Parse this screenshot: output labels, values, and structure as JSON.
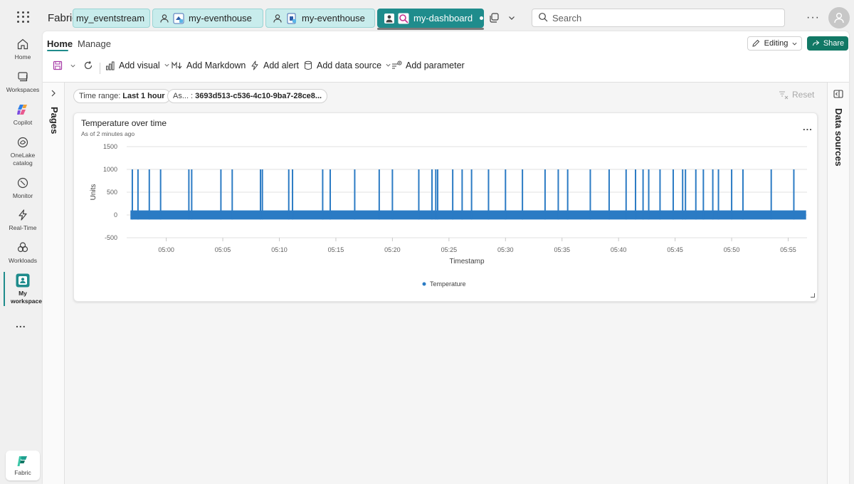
{
  "app": {
    "brand": "Fabric"
  },
  "tabs": [
    {
      "label": "my_eventstream"
    },
    {
      "label": "my-eventhouse"
    },
    {
      "label": "my-eventhouse"
    },
    {
      "label": "my-dashboard",
      "active": true
    }
  ],
  "search": {
    "placeholder": "Search"
  },
  "rail": {
    "items": [
      {
        "label": "Home"
      },
      {
        "label": "Workspaces"
      },
      {
        "label": "Copilot"
      },
      {
        "label": "OneLake catalog"
      },
      {
        "label": "Monitor"
      },
      {
        "label": "Real-Time"
      },
      {
        "label": "Workloads"
      },
      {
        "label": "My workspace"
      }
    ],
    "more": "...",
    "fabric_label": "Fabric"
  },
  "ribbon": {
    "tabs": [
      "Home",
      "Manage"
    ],
    "editing_label": "Editing",
    "share_label": "Share"
  },
  "toolbar": {
    "add_visual": "Add visual",
    "add_markdown": "Add Markdown",
    "add_alert": "Add alert",
    "add_data_source": "Add data source",
    "add_parameter": "Add parameter"
  },
  "pages_label": "Pages",
  "data_sources_label": "Data sources",
  "filters": {
    "time_range_label": "Time range:",
    "time_range_value": "Last 1 hour",
    "param_label": "As... :",
    "param_value": "3693d513-c536-4c10-9ba7-28ce8...",
    "reset_label": "Reset"
  },
  "tile": {
    "title": "Temperature over time",
    "subtitle": "As of 2 minutes ago",
    "more": "..."
  },
  "colors": {
    "accent": "#1f8c8c",
    "share": "#117865",
    "series": "#2b7bc4"
  },
  "chart_data": {
    "type": "line",
    "xlabel": "Timestamp",
    "ylabel": "Units",
    "ylim": [
      -500,
      1500
    ],
    "yticks": [
      1500,
      1000,
      500,
      0,
      -500
    ],
    "xticks": [
      "05:00",
      "05:05",
      "05:10",
      "05:15",
      "05:20",
      "05:25",
      "05:30",
      "05:35",
      "05:40",
      "05:45",
      "05:50",
      "05:55"
    ],
    "xlim": [
      "04:56:30",
      "05:56:40"
    ],
    "grid": true,
    "legend_placement": "bottom",
    "series": [
      {
        "name": "Temperature",
        "baseline_range": [
          -100,
          100
        ],
        "spike_value": 1000,
        "spike_times": [
          "04:57:00",
          "04:57:30",
          "04:58:30",
          "04:59:30",
          "05:02:00",
          "05:02:15",
          "05:04:50",
          "05:05:50",
          "05:08:20",
          "05:08:30",
          "05:10:50",
          "05:11:10",
          "05:13:50",
          "05:14:30",
          "05:16:40",
          "05:18:50",
          "05:20:00",
          "05:22:20",
          "05:23:30",
          "05:23:50",
          "05:24:00",
          "05:25:20",
          "05:26:10",
          "05:27:00",
          "05:28:30",
          "05:30:00",
          "05:31:30",
          "05:33:30",
          "05:34:40",
          "05:35:30",
          "05:37:30",
          "05:39:10",
          "05:40:40",
          "05:41:30",
          "05:42:10",
          "05:42:40",
          "05:43:40",
          "05:44:50",
          "05:45:40",
          "05:45:55",
          "05:46:50",
          "05:47:30",
          "05:48:20",
          "05:48:50",
          "05:50:00",
          "05:51:00",
          "05:53:30",
          "05:55:30"
        ]
      }
    ]
  }
}
